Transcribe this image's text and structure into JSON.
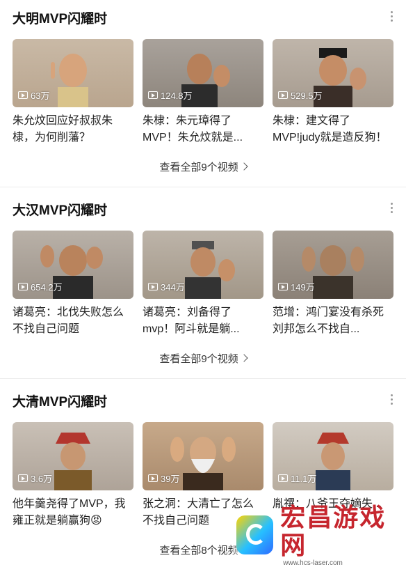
{
  "sections": [
    {
      "title": "大明MVP闪耀时",
      "videos": [
        {
          "views": "63万",
          "title": "朱允炆回应好叔叔朱棣，为何削藩？"
        },
        {
          "views": "124.8万",
          "title": "朱棣：朱元璋得了MVP！朱允炆就是..."
        },
        {
          "views": "529.5万",
          "title": "朱棣：建文得了MVP!judy就是造反狗！"
        }
      ],
      "see_all": "查看全部9个视频"
    },
    {
      "title": "大汉MVP闪耀时",
      "videos": [
        {
          "views": "654.2万",
          "title": "诸葛亮：北伐失败怎么不找自己问题"
        },
        {
          "views": "344万",
          "title": "诸葛亮：刘备得了mvp！阿斗就是躺..."
        },
        {
          "views": "149万",
          "title": "范增：鸿门宴没有杀死刘邦怎么不找自..."
        }
      ],
      "see_all": "查看全部9个视频"
    },
    {
      "title": "大清MVP闪耀时",
      "videos": [
        {
          "views": "3.6万",
          "title": "他年羹尧得了MVP，我雍正就是躺赢狗😡"
        },
        {
          "views": "39万",
          "title": "张之洞：大清亡了怎么不找自己问题"
        },
        {
          "views": "11.1万",
          "title": "胤禩：八爷王夺嫡失..."
        }
      ],
      "see_all": "查看全部8个视频"
    }
  ],
  "watermark": {
    "name": "宏昌游戏网",
    "url": "www.hcs-laser.com"
  },
  "colors": {
    "accent_red": "#c6262e",
    "text": "#222222",
    "divider": "#ececec"
  }
}
